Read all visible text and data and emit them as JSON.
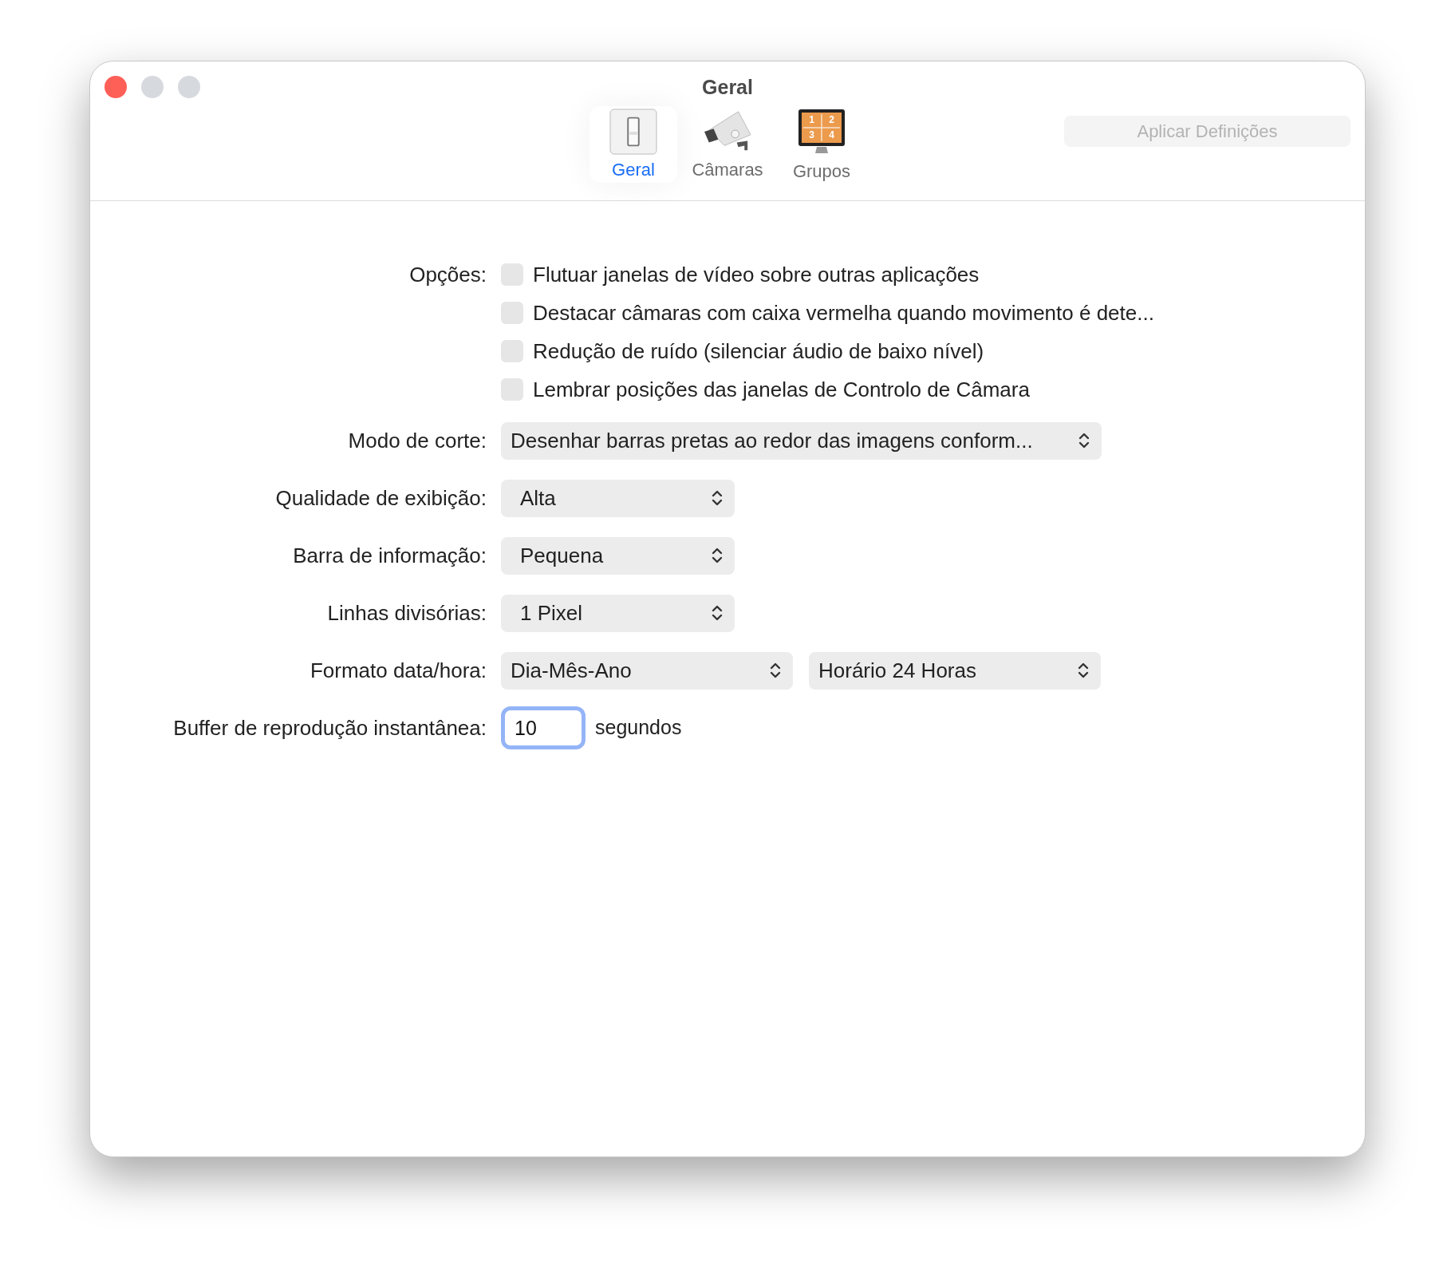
{
  "window": {
    "title": "Geral",
    "controls": [
      {
        "kind": "close",
        "disabled": false
      },
      {
        "kind": "minimize",
        "disabled": true
      },
      {
        "kind": "zoom",
        "disabled": true
      }
    ]
  },
  "toolbar": {
    "tabs": [
      {
        "label": "Geral",
        "kind": "switch",
        "selected": true
      },
      {
        "label": "Câmaras",
        "kind": "camera",
        "selected": false
      },
      {
        "label": "Grupos",
        "kind": "grid",
        "selected": false,
        "icon_digits": [
          "1",
          "2",
          "3",
          "4"
        ]
      }
    ],
    "apply_button": {
      "label": "Aplicar Definições",
      "disabled": true
    }
  },
  "options": {
    "label": "Opções:",
    "items": [
      {
        "label": "Flutuar janelas de vídeo sobre outras aplicações",
        "checked": false
      },
      {
        "label": "Destacar câmaras com caixa vermelha quando movimento é dete...",
        "checked": false
      },
      {
        "label": "Redução de ruído (silenciar áudio de baixo nível)",
        "checked": false
      },
      {
        "label": "Lembrar posições das janelas de Controlo de Câmara",
        "checked": false
      }
    ]
  },
  "settings": [
    {
      "label": "Modo de corte:",
      "popups": [
        {
          "value": "Desenhar barras pretas ao redor das imagens conform..."
        }
      ]
    },
    {
      "label": "Qualidade de exibição:",
      "popups": [
        {
          "value": "Alta"
        }
      ]
    },
    {
      "label": "Barra de informação:",
      "popups": [
        {
          "value": "Pequena"
        }
      ]
    },
    {
      "label": "Linhas divisórias:",
      "popups": [
        {
          "value": "1 Pixel"
        }
      ]
    },
    {
      "label": "Formato data/hora:",
      "popups": [
        {
          "value": "Dia-Mês-Ano"
        },
        {
          "value": "Horário 24 Horas"
        }
      ]
    }
  ],
  "buffer": {
    "label": "Buffer de reprodução instantânea:",
    "value": "10",
    "unit": "segundos",
    "focused": true
  }
}
